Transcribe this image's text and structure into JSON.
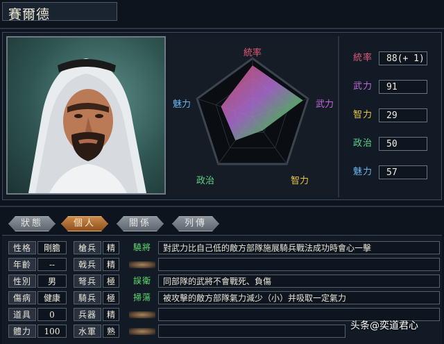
{
  "general_name": "賽爾德",
  "radar": {
    "labels": {
      "leadership": "統率",
      "force": "武力",
      "intelligence": "智力",
      "politics": "政治",
      "charm": "魅力"
    },
    "values": {
      "leadership": 88,
      "force": 91,
      "intelligence": 29,
      "politics": 50,
      "charm": 57
    },
    "max": 100
  },
  "stats": [
    {
      "label": "統率",
      "value": "88(+ 1)",
      "color": "#e05a78"
    },
    {
      "label": "武力",
      "value": "91",
      "color": "#c06ad8"
    },
    {
      "label": "智力",
      "value": "29",
      "color": "#e8c640"
    },
    {
      "label": "政治",
      "value": "50",
      "color": "#5ed48a"
    },
    {
      "label": "魅力",
      "value": "57",
      "color": "#6ab6f0"
    }
  ],
  "tabs": [
    {
      "label": "狀態",
      "active": false
    },
    {
      "label": "個人",
      "active": true
    },
    {
      "label": "關係",
      "active": false
    },
    {
      "label": "列傳",
      "active": false
    }
  ],
  "personal": [
    {
      "label": "性格",
      "value": "剛膽"
    },
    {
      "label": "年齡",
      "value": "--"
    },
    {
      "label": "性別",
      "value": "男"
    },
    {
      "label": "傷病",
      "value": "健康"
    },
    {
      "label": "道具",
      "value": "0"
    },
    {
      "label": "體力",
      "value": "100"
    }
  ],
  "aptitude": [
    {
      "label": "槍兵",
      "value": "精"
    },
    {
      "label": "戟兵",
      "value": "精"
    },
    {
      "label": "弩兵",
      "value": "極"
    },
    {
      "label": "騎兵",
      "value": "極"
    },
    {
      "label": "兵器",
      "value": "精"
    },
    {
      "label": "水軍",
      "value": "熟"
    }
  ],
  "skills": [
    {
      "name": "驍將",
      "desc": "對武力比自己低的敵方部隊施展騎兵戰法成功時會心一擊"
    },
    {
      "name": "",
      "desc": ""
    },
    {
      "name": "誤衛",
      "desc": "同部隊的武將不會戰死、負傷"
    },
    {
      "name": "掃蕩",
      "desc": "被攻擊的敵方部隊氣力減少（小）并吸取一定氣力"
    },
    {
      "name": "",
      "desc": ""
    },
    {
      "name": "",
      "desc": ""
    }
  ],
  "watermark": "头条@奕道君心"
}
